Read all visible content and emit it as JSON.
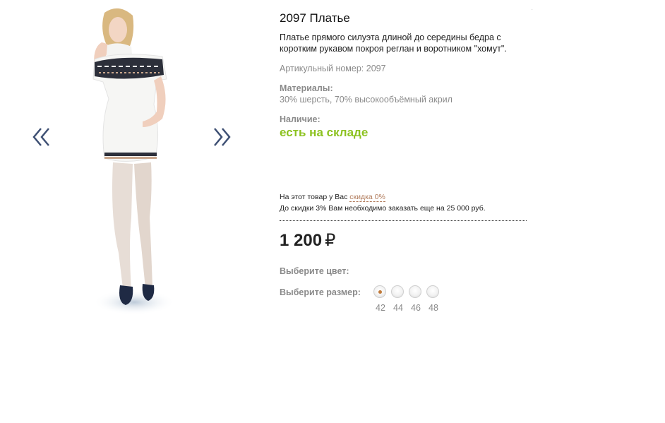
{
  "product": {
    "title": "2097 Платье",
    "description": "Платье прямого силуэта длиной до середины бедра с коротким рукавом покроя реглан и воротником \"хомут\".",
    "article_label": "Артикульный номер: 2097",
    "materials_label": "Материалы:",
    "materials_value": "30% шерсть, 70% высокообъёмный акрил",
    "availability_label": "Наличие:",
    "availability_value": "есть на складе",
    "availability_color": "#8cc21f"
  },
  "discount": {
    "line1_prefix": "На этот товар у Вас ",
    "line1_link": "скидка 0%",
    "line2": "До скидки 3% Вам необходимо заказать еще на 25 000 руб."
  },
  "price": {
    "amount": "1 200",
    "currency": "₽"
  },
  "color": {
    "label": "Выберите цвет:"
  },
  "size": {
    "label": "Выберите размер:",
    "options": [
      "42",
      "44",
      "46",
      "48"
    ],
    "selected": "42"
  },
  "gallery": {
    "prev_icon": "double-chevron-left-icon",
    "next_icon": "double-chevron-right-icon",
    "arrow_color": "#3d4f73"
  }
}
